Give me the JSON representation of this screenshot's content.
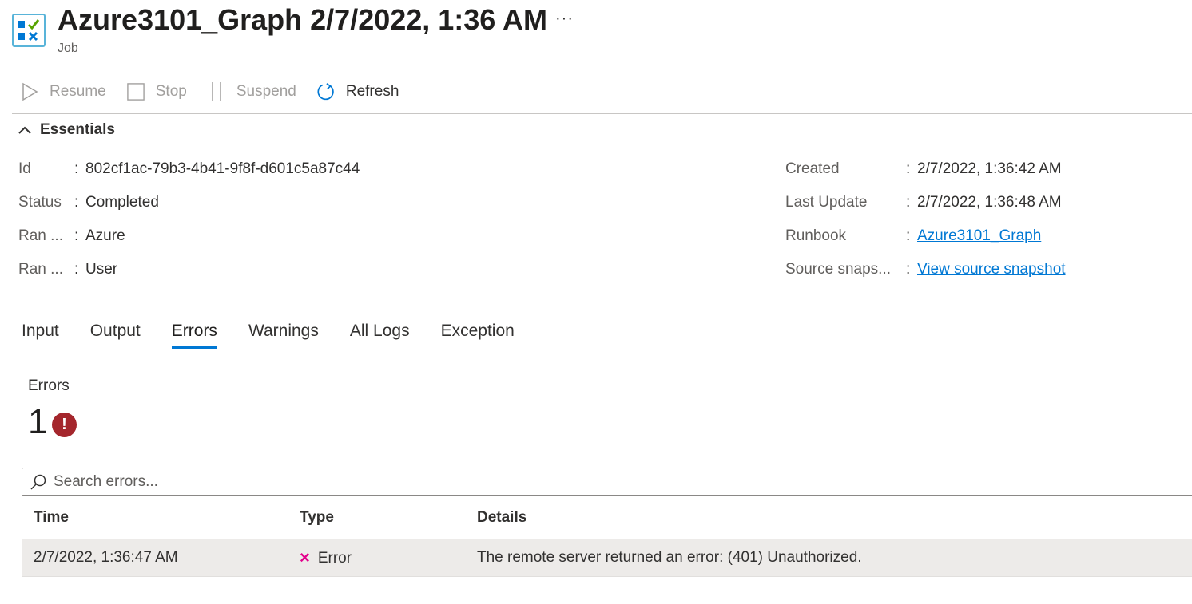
{
  "header": {
    "title": "Azure3101_Graph 2/7/2022, 1:36 AM",
    "subtitle": "Job",
    "more": "···",
    "icon": "job-checklist-icon"
  },
  "toolbar": {
    "resume": "Resume",
    "stop": "Stop",
    "suspend": "Suspend",
    "refresh": "Refresh"
  },
  "essentials": {
    "toggle_label": "Essentials",
    "left": [
      {
        "key": "Id",
        "value": "802cf1ac-79b3-4b41-9f8f-d601c5a87c44"
      },
      {
        "key": "Status",
        "value": "Completed"
      },
      {
        "key": "Ran ...",
        "value": "Azure"
      },
      {
        "key": "Ran ...",
        "value": "User"
      }
    ],
    "right": [
      {
        "key": "Created",
        "value": "2/7/2022, 1:36:42 AM"
      },
      {
        "key": "Last Update",
        "value": "2/7/2022, 1:36:48 AM"
      },
      {
        "key": "Runbook",
        "value": "Azure3101_Graph"
      },
      {
        "key": "Source snaps...",
        "value": "View source snapshot"
      }
    ]
  },
  "tabs": [
    "Input",
    "Output",
    "Errors",
    "Warnings",
    "All Logs",
    "Exception"
  ],
  "active_tab": "Errors",
  "errors_summary": {
    "label": "Errors",
    "count": "1",
    "badge": "!"
  },
  "search": {
    "placeholder": "Search errors..."
  },
  "table": {
    "columns": [
      "Time",
      "Type",
      "Details"
    ],
    "rows": [
      {
        "time": "2/7/2022, 1:36:47 AM",
        "type_icon": "×",
        "type": "Error",
        "details": "The remote server returned an error: (401) Unauthorized."
      }
    ]
  },
  "colors": {
    "accent": "#0078d4",
    "error_badge": "#a4262c",
    "error_x": "#e3008c",
    "row_bg": "#edebe9"
  }
}
